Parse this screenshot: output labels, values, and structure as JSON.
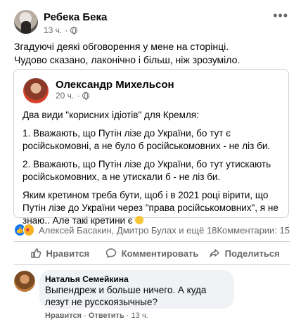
{
  "post": {
    "author": "Ребека Бека",
    "time": "13 ч.",
    "text_line1": "Згадуючі деякі обговорення у мене на сторінці.",
    "text_line2": "Чудово сказано, лаконічно і більш, ніж зрозуміло."
  },
  "shared": {
    "author": "Олександр Михельсон",
    "time": "20 ч.",
    "p1": "Два види \"корисних ідіотів\" для Кремля:",
    "p2": "1. Вважають, що Путін лізе до України, бо тут є російськомовні, а не було б російськомовних - не ліз би.",
    "p3": "2. Вважають, що Путін лізе до України, бо тут утискають російськомовних, а не утискали б - не ліз би.",
    "p4": "Яким кретином треба бути, щоб і в 2021 році вірити, що Путін лізе до України через \"права російськомовних\", я не знаю.. Але такі кретини є"
  },
  "reactions": {
    "names": "Алексей Басакин, Дмитро Булах и ещё 18",
    "comments": "Комментарии: 15"
  },
  "actions": {
    "like": "Нравится",
    "comment": "Комментировать",
    "share": "Поделиться"
  },
  "comment": {
    "author": "Наталья Семейкина",
    "text": "Выпендреж и больше ничего. А куда лезут не русскоязычные?",
    "like": "Нравится",
    "reply": "Ответить",
    "time": "13 ч."
  },
  "icons": {
    "privacy": "globe-icon",
    "menu": "more-icon",
    "like": "thumbs-up-icon",
    "comment": "comment-icon",
    "share": "share-icon"
  },
  "colors": {
    "accent": "#1877f2",
    "muted": "#65676b",
    "divider": "#ced0d4"
  }
}
